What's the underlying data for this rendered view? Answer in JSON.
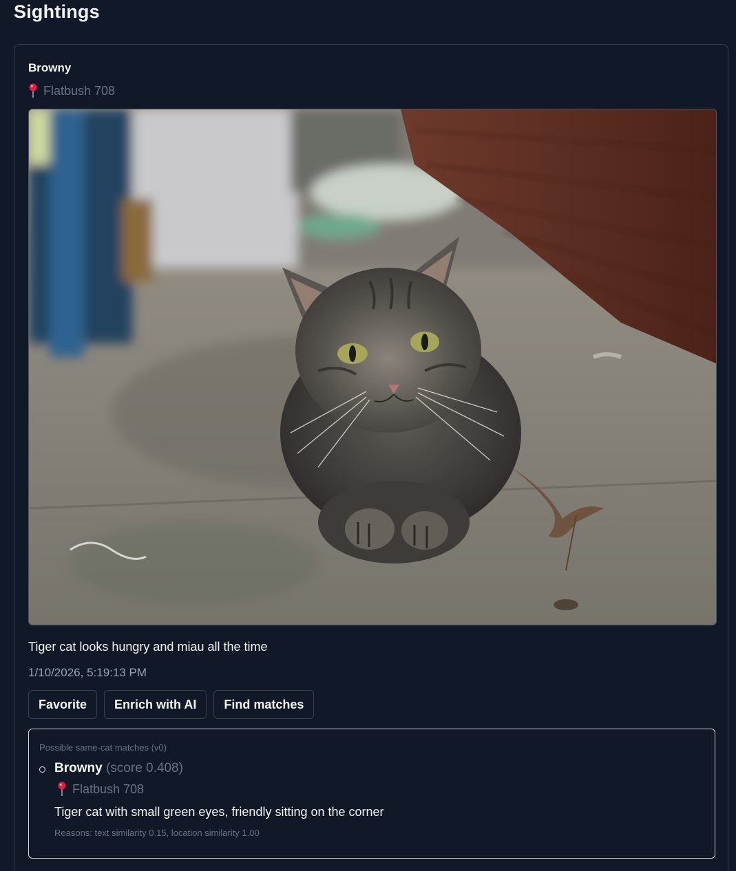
{
  "page": {
    "title": "Sightings"
  },
  "sighting": {
    "name": "Browny",
    "location": "Flatbush 708",
    "photo_alt": "Tiger cat sitting on a sidewalk",
    "description": "Tiger cat looks hungry and miau all the time",
    "timestamp": "1/10/2026, 5:19:13 PM",
    "actions": {
      "favorite": "Favorite",
      "enrich": "Enrich with AI",
      "find_matches": "Find matches"
    }
  },
  "matches": {
    "heading": "Possible same-cat matches (v0)",
    "items": [
      {
        "name": "Browny",
        "score": "(score 0.408)",
        "location": "Flatbush 708",
        "description": "Tiger cat with small green eyes, friendly sitting on the corner",
        "reasons": "Reasons: text similarity 0.15, location similarity 1.00"
      }
    ]
  },
  "icons": {
    "location": "map-pin-icon",
    "bullet": "hollow-circle-bullet"
  },
  "colors": {
    "background": "#111827",
    "border": "#374151",
    "muted": "#6b7280",
    "pin": "#e11d48"
  }
}
